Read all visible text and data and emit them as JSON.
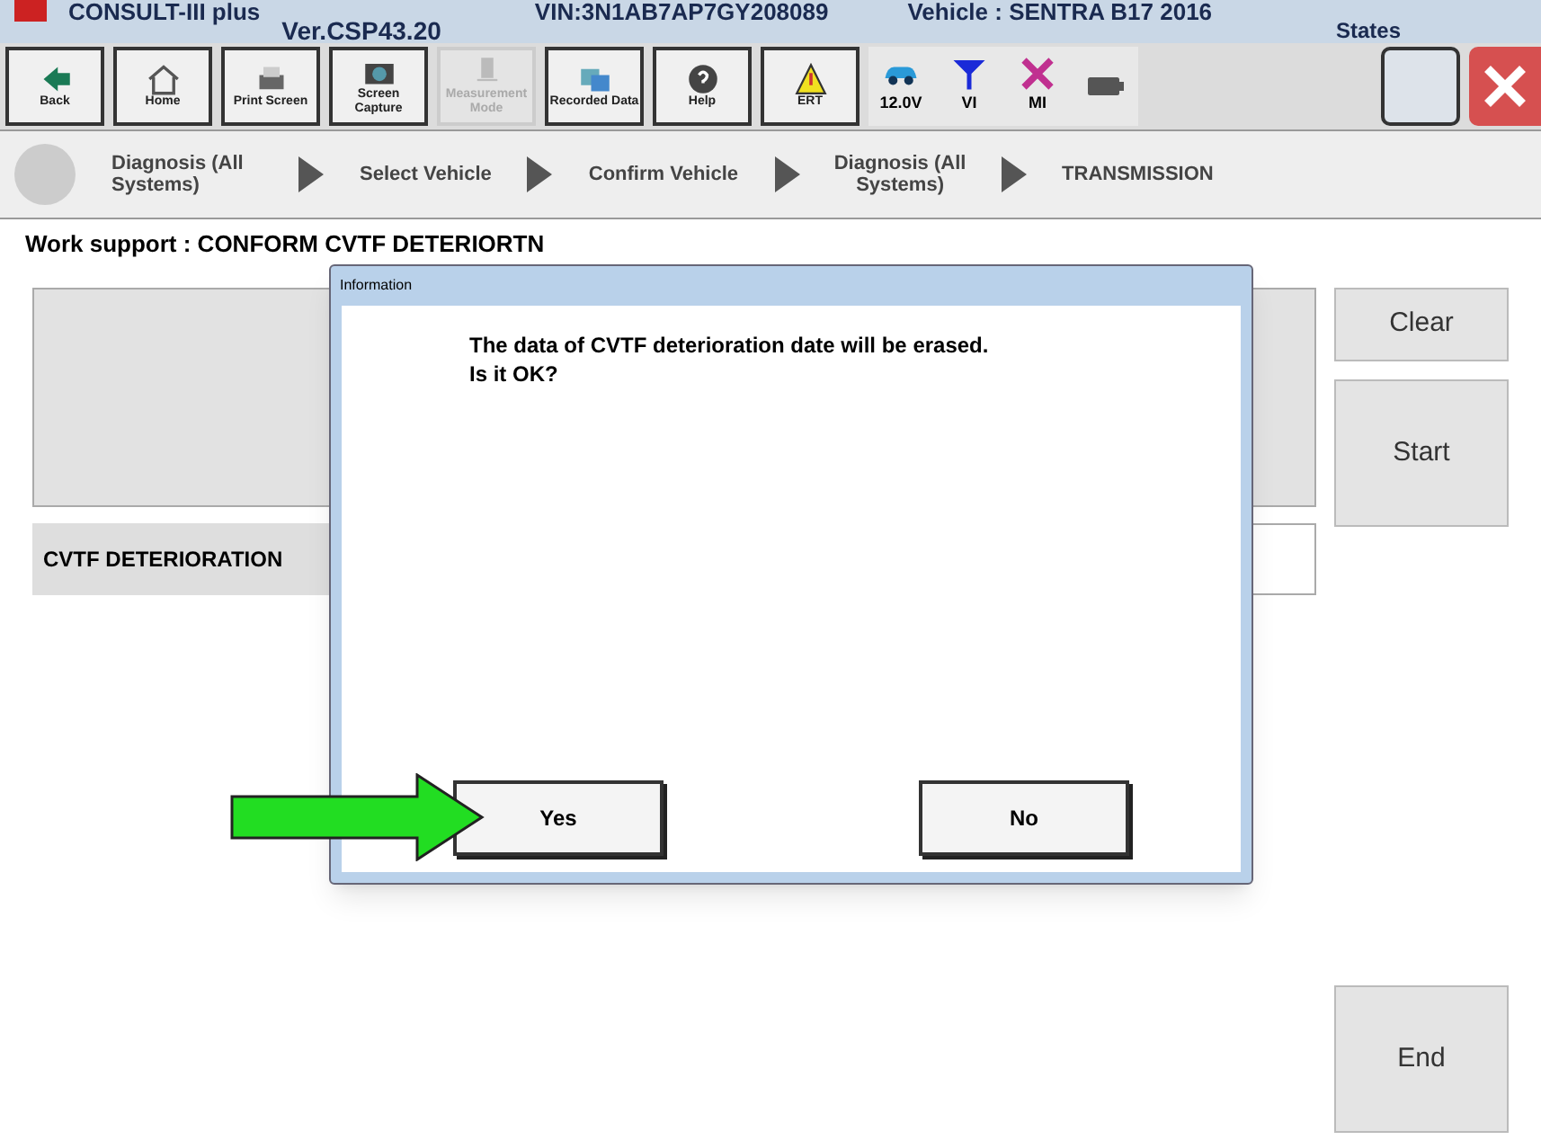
{
  "header": {
    "app": "CONSULT-III plus",
    "version": "Ver.CSP43.20",
    "vin": "VIN:3N1AB7AP7GY208089",
    "vehicle": "Vehicle : SENTRA B17 2016",
    "states": "States"
  },
  "toolbar": [
    {
      "label": "Back",
      "kind": "back",
      "disabled": false
    },
    {
      "label": "Home",
      "kind": "home",
      "disabled": false
    },
    {
      "label": "Print Screen",
      "kind": "print",
      "disabled": false
    },
    {
      "label": "Screen Capture",
      "kind": "camera",
      "disabled": false
    },
    {
      "label": "Measurement Mode",
      "kind": "meter",
      "disabled": true
    },
    {
      "label": "Recorded Data",
      "kind": "data",
      "disabled": false
    },
    {
      "label": "Help",
      "kind": "help",
      "disabled": false
    },
    {
      "label": "ERT",
      "kind": "warning",
      "disabled": false
    }
  ],
  "indicators": [
    {
      "label": "12.0V",
      "kind": "car"
    },
    {
      "label": "VI",
      "kind": "signal"
    },
    {
      "label": "MI",
      "kind": "cross"
    },
    {
      "kind": "battery"
    }
  ],
  "breadcrumb": [
    "Diagnosis (All Systems)",
    "Select Vehicle",
    "Confirm Vehicle",
    "Diagnosis (All Systems)",
    "TRANSMISSION"
  ],
  "page_title": "Work support : CONFORM CVTF DETERIORTN",
  "item_label": "CVTF DETERIORATION",
  "side_buttons": [
    "Clear",
    "Start"
  ],
  "end_button": "End",
  "dialog": {
    "title": "Information",
    "message": [
      "The data of CVTF deterioration date will be erased.",
      "Is it OK?"
    ],
    "buttons": [
      "Yes",
      "No"
    ]
  }
}
